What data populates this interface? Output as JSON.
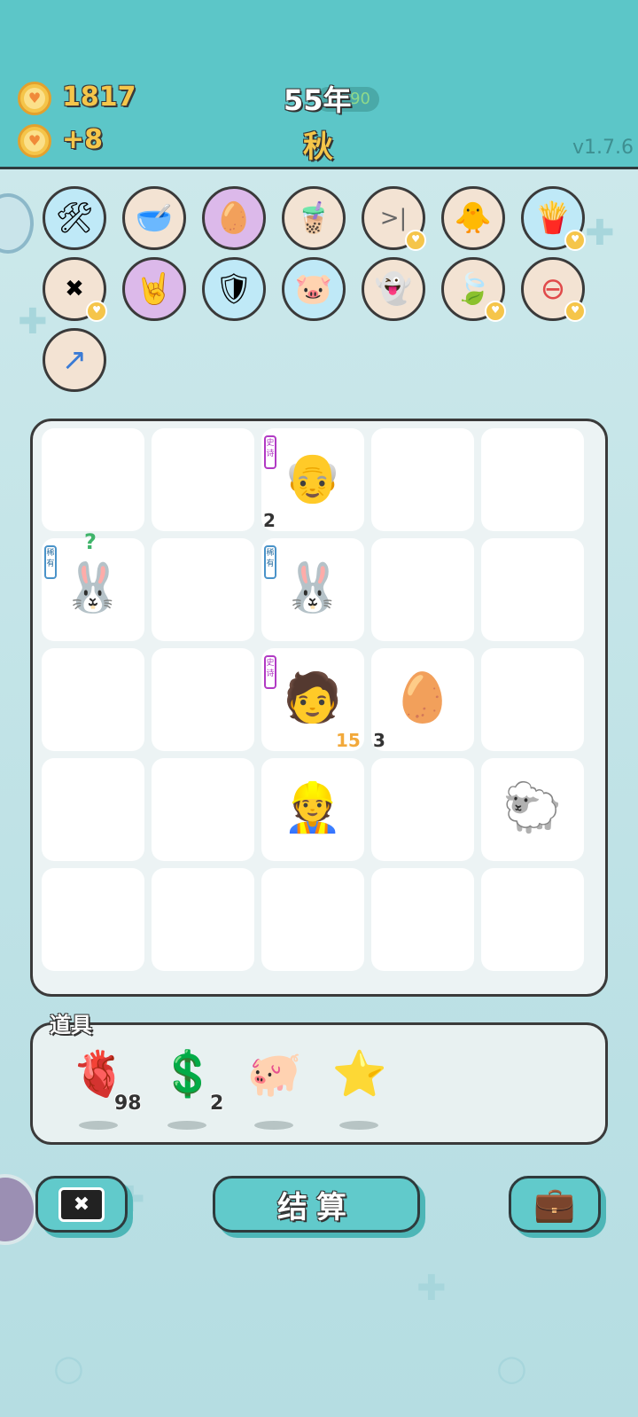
{
  "header": {
    "coins": "1817",
    "income": "+8",
    "year": "55年",
    "year_badge": "90",
    "season": "秋",
    "version": "v1.7.6"
  },
  "relics": [
    {
      "name": "pump",
      "icon": "🛠"
    },
    {
      "name": "pet-food-bowl",
      "icon": "🥣"
    },
    {
      "name": "egg-nest",
      "icon": "🥚"
    },
    {
      "name": "bubble-tea",
      "icon": "🧋"
    },
    {
      "name": "skip",
      "icon": ">|"
    },
    {
      "name": "chick-egg",
      "icon": "🐥"
    },
    {
      "name": "fries",
      "icon": "🍟"
    },
    {
      "name": "remove-tag",
      "icon": "✖"
    },
    {
      "name": "rock-hand",
      "icon": "🤘"
    },
    {
      "name": "shield-wrench",
      "icon": "🛡"
    },
    {
      "name": "piggy-bank",
      "icon": "🐷"
    },
    {
      "name": "ghost",
      "icon": "👻"
    },
    {
      "name": "leaf",
      "icon": "🍃"
    },
    {
      "name": "no-entry",
      "icon": "⊖"
    },
    {
      "name": "arrow-up",
      "icon": "↗"
    }
  ],
  "board": {
    "tags": {
      "epic": "史诗",
      "rare": "稀有"
    },
    "cells": [
      {
        "pos": "r1c3",
        "symbol": "old-man",
        "icon": "👴",
        "tag": "epic",
        "count": "2"
      },
      {
        "pos": "r2c1",
        "symbol": "bunny",
        "icon": "🐰",
        "tag": "rare",
        "question": "?"
      },
      {
        "pos": "r2c3",
        "symbol": "bunny",
        "icon": "🐰",
        "tag": "rare"
      },
      {
        "pos": "r3c3",
        "symbol": "person",
        "icon": "🧑",
        "tag": "epic",
        "count": "15"
      },
      {
        "pos": "r3c4",
        "symbol": "egg",
        "icon": "🥚",
        "count": "3"
      },
      {
        "pos": "r4c3",
        "symbol": "worker",
        "icon": "👷",
        "tag": ""
      },
      {
        "pos": "r4c5",
        "symbol": "sheep",
        "icon": "🐑",
        "tag": ""
      }
    ]
  },
  "items": {
    "title": "道具",
    "list": [
      {
        "name": "liver",
        "icon": "🫀",
        "count": "98"
      },
      {
        "name": "coin",
        "icon": "💲",
        "count": "2"
      },
      {
        "name": "piggy-bank",
        "icon": "🐖",
        "count": ""
      },
      {
        "name": "star",
        "icon": "⭐",
        "count": ""
      }
    ]
  },
  "buttons": {
    "remove_icon": "✖",
    "settle_label": "结算",
    "bag_icon": "💼"
  }
}
